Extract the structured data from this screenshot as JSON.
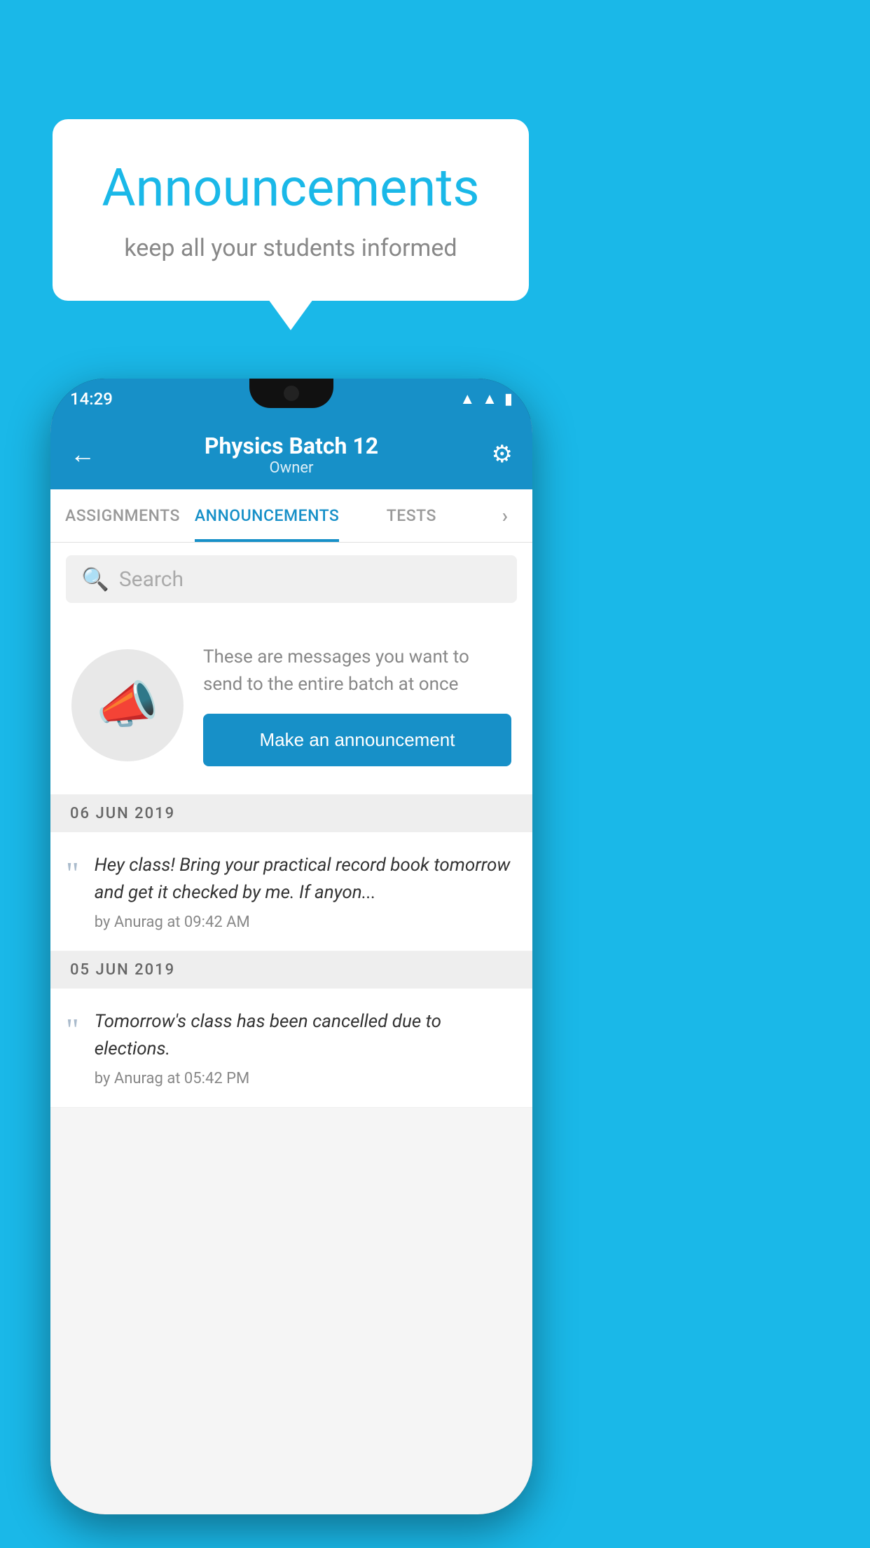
{
  "background_color": "#1ab8e8",
  "speech_bubble": {
    "title": "Announcements",
    "subtitle": "keep all your students informed"
  },
  "phone": {
    "status_bar": {
      "time": "14:29",
      "icons": [
        "wifi",
        "signal",
        "battery"
      ]
    },
    "header": {
      "back_label": "←",
      "title": "Physics Batch 12",
      "subtitle": "Owner",
      "settings_label": "⚙"
    },
    "tabs": [
      {
        "label": "ASSIGNMENTS",
        "active": false
      },
      {
        "label": "ANNOUNCEMENTS",
        "active": true
      },
      {
        "label": "TESTS",
        "active": false
      },
      {
        "label": "•••",
        "active": false
      }
    ],
    "search": {
      "placeholder": "Search"
    },
    "announcement_prompt": {
      "description_text": "These are messages you want to send to the entire batch at once",
      "button_label": "Make an announcement"
    },
    "announcements": [
      {
        "date": "06  JUN  2019",
        "items": [
          {
            "text": "Hey class! Bring your practical record book tomorrow and get it checked by me. If anyon...",
            "meta": "by Anurag at 09:42 AM"
          }
        ]
      },
      {
        "date": "05  JUN  2019",
        "items": [
          {
            "text": "Tomorrow's class has been cancelled due to elections.",
            "meta": "by Anurag at 05:42 PM"
          }
        ]
      }
    ]
  }
}
